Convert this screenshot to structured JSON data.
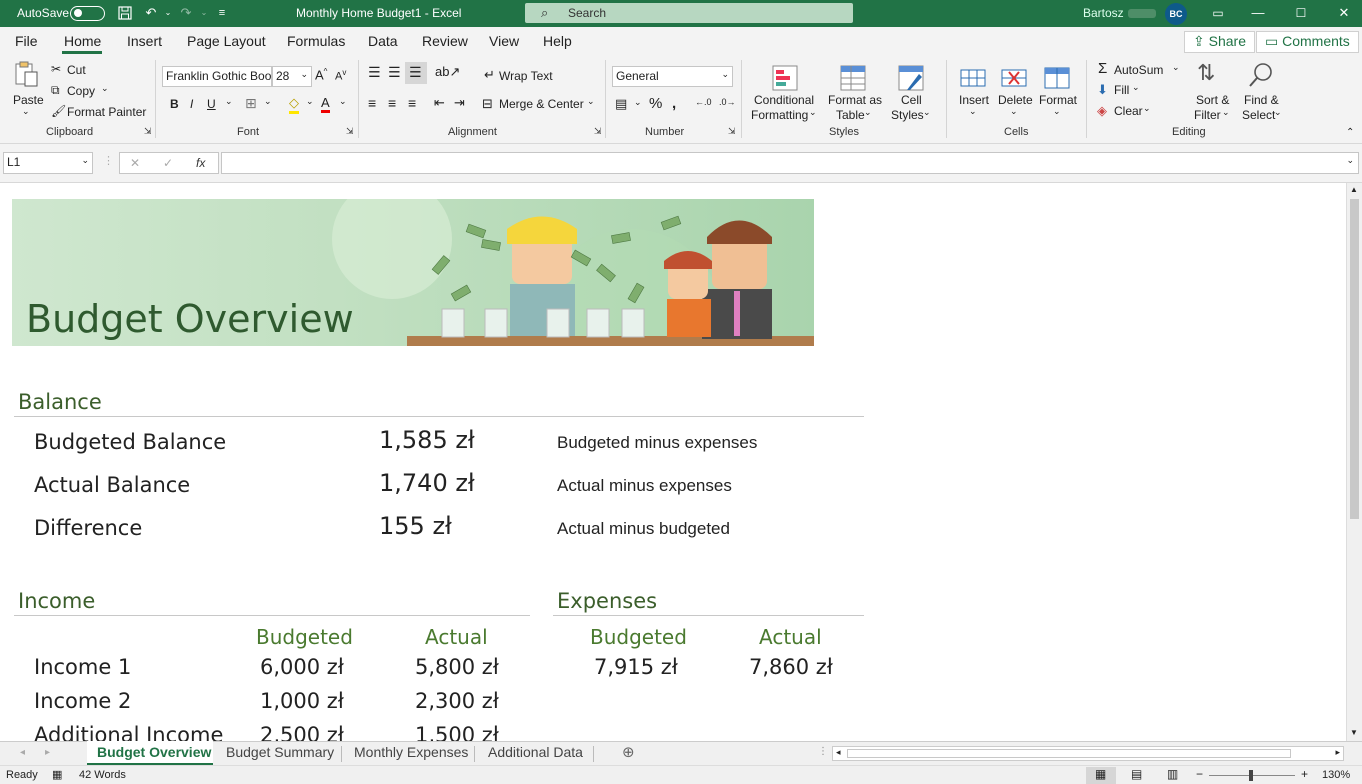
{
  "titlebar": {
    "autosave_label": "AutoSave",
    "doc_title": "Monthly Home Budget1  -  Excel",
    "search_placeholder": "Search",
    "user_name": "Bartosz",
    "user_initials": "BC"
  },
  "tabs": [
    "File",
    "Home",
    "Insert",
    "Page Layout",
    "Formulas",
    "Data",
    "Review",
    "View",
    "Help"
  ],
  "active_tab": "Home",
  "share_label": "Share",
  "comments_label": "Comments",
  "ribbon": {
    "paste": "Paste",
    "cut": "Cut",
    "copy": "Copy",
    "format_painter": "Format Painter",
    "clipboard": "Clipboard",
    "font_name": "Franklin Gothic Book",
    "font_size": "28",
    "bold": "B",
    "italic": "I",
    "underline": "U",
    "font": "Font",
    "wrap_text": "Wrap Text",
    "merge_center": "Merge & Center",
    "alignment": "Alignment",
    "number_format": "General",
    "number": "Number",
    "conditional_formatting_1": "Conditional",
    "conditional_formatting_2": "Formatting",
    "format_as_table_1": "Format as",
    "format_as_table_2": "Table",
    "cell_styles_1": "Cell",
    "cell_styles_2": "Styles",
    "styles": "Styles",
    "insert": "Insert",
    "delete": "Delete",
    "format": "Format",
    "cells": "Cells",
    "autosum": "AutoSum",
    "fill": "Fill",
    "clear": "Clear",
    "sort_filter_1": "Sort &",
    "sort_filter_2": "Filter",
    "find_select_1": "Find &",
    "find_select_2": "Select",
    "editing": "Editing"
  },
  "formula_bar": {
    "name_box": "L1",
    "fx": "fx",
    "content": ""
  },
  "sheet": {
    "banner_title": "Budget Overview",
    "balance": {
      "heading": "Balance",
      "rows": [
        {
          "label": "Budgeted Balance",
          "value": "1,585  zł",
          "note": "Budgeted minus expenses"
        },
        {
          "label": "Actual Balance",
          "value": "1,740  zł",
          "note": "Actual minus expenses"
        },
        {
          "label": "Difference",
          "value": "155  zł",
          "note": "Actual minus budgeted"
        }
      ]
    },
    "income": {
      "heading": "Income",
      "col_budgeted": "Budgeted",
      "col_actual": "Actual",
      "rows": [
        {
          "label": "Income 1",
          "budgeted": "6,000  zł",
          "actual": "5,800  zł"
        },
        {
          "label": "Income 2",
          "budgeted": "1,000  zł",
          "actual": "2,300  zł"
        },
        {
          "label": "Additional Income",
          "budgeted": "2,500  zł",
          "actual": "1,500  zł"
        }
      ]
    },
    "expenses": {
      "heading": "Expenses",
      "col_budgeted": "Budgeted",
      "col_actual": "Actual",
      "budgeted": "7,915  zł",
      "actual": "7,860  zł"
    }
  },
  "sheet_tabs": [
    "Budget Overview",
    "Budget Summary",
    "Monthly Expenses",
    "Additional Data"
  ],
  "active_sheet": "Budget Overview",
  "status": {
    "ready": "Ready",
    "words": "42 Words",
    "zoom": "130%"
  },
  "colors": {
    "excel_green": "#217346",
    "heading_green": "#3b5e2b",
    "column_header_green": "#4a7a2f"
  }
}
